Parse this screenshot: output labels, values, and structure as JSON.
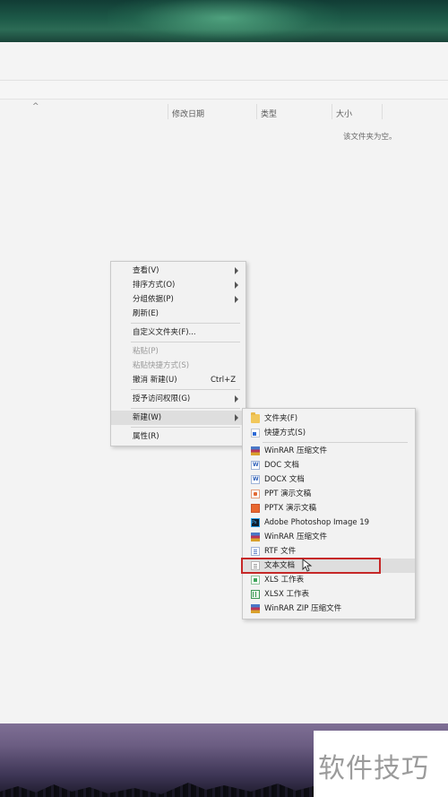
{
  "columns": {
    "sort_caret": "^",
    "modified": "修改日期",
    "type": "类型",
    "size": "大小"
  },
  "empty_message": "该文件夹为空。",
  "context_menu": {
    "items": [
      {
        "label": "查看(V)",
        "submenu": true
      },
      {
        "label": "排序方式(O)",
        "submenu": true
      },
      {
        "label": "分组依据(P)",
        "submenu": true
      },
      {
        "label": "刷新(E)"
      },
      {
        "label": "自定义文件夹(F)..."
      },
      {
        "label": "粘贴(P)",
        "disabled": true
      },
      {
        "label": "粘贴快捷方式(S)",
        "disabled": true
      },
      {
        "label": "撤消 新建(U)",
        "shortcut": "Ctrl+Z"
      },
      {
        "label": "授予访问权限(G)",
        "submenu": true
      },
      {
        "label": "新建(W)",
        "submenu": true,
        "highlighted": true
      },
      {
        "label": "属性(R)"
      }
    ]
  },
  "new_submenu": {
    "items": [
      {
        "label": "文件夹(F)",
        "icon": "folder-icon"
      },
      {
        "label": "快捷方式(S)",
        "icon": "shortcut-icon"
      },
      {
        "label": "WinRAR 压缩文件",
        "icon": "winrar-icon"
      },
      {
        "label": "DOC 文档",
        "icon": "doc-icon"
      },
      {
        "label": "DOCX 文档",
        "icon": "docx-icon"
      },
      {
        "label": "PPT 演示文稿",
        "icon": "ppt-icon"
      },
      {
        "label": "PPTX 演示文稿",
        "icon": "pptx-icon"
      },
      {
        "label": "Adobe Photoshop Image 19",
        "icon": "photoshop-icon"
      },
      {
        "label": "WinRAR 压缩文件",
        "icon": "winrar-icon"
      },
      {
        "label": "RTF 文件",
        "icon": "rtf-icon"
      },
      {
        "label": "文本文档",
        "icon": "text-document-icon",
        "highlighted": true
      },
      {
        "label": "XLS 工作表",
        "icon": "xls-icon"
      },
      {
        "label": "XLSX 工作表",
        "icon": "xlsx-icon"
      },
      {
        "label": "WinRAR ZIP 压缩文件",
        "icon": "winrar-zip-icon"
      }
    ]
  },
  "watermark": "软件技巧",
  "colors": {
    "highlight_box": "#c62828",
    "menu_background": "#f2f2f2",
    "hover_background": "#dedede"
  }
}
